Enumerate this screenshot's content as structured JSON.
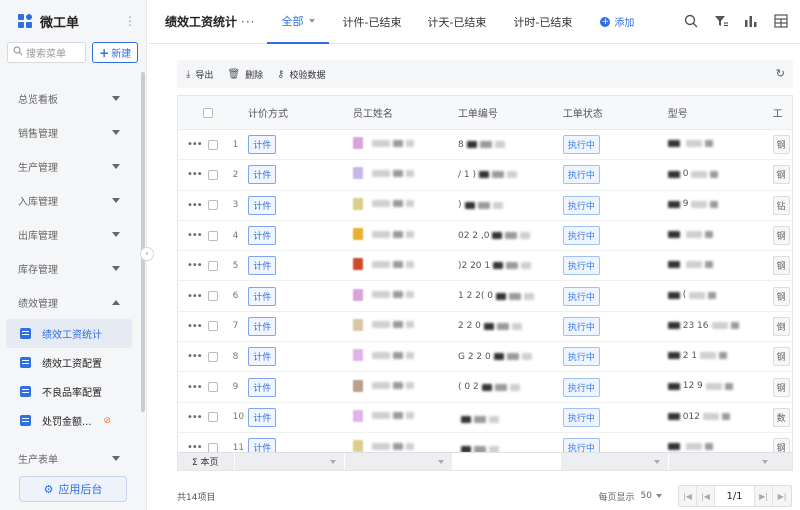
{
  "sidebar": {
    "app_title": "微工单",
    "search_placeholder": "搜索菜单",
    "new_button": "新建",
    "groups": [
      {
        "label": "总览看板"
      },
      {
        "label": "销售管理"
      },
      {
        "label": "生产管理"
      },
      {
        "label": "入库管理"
      },
      {
        "label": "出库管理"
      },
      {
        "label": "库存管理"
      }
    ],
    "perf_group": "绩效管理",
    "sub_items": [
      "绩效工资统计",
      "绩效工资配置",
      "不良品率配置",
      "处罚金额..."
    ],
    "prod_report": "生产表单",
    "app_backend": "应用后台"
  },
  "topbar": {
    "page_title": "绩效工资统计",
    "tabs": [
      "全部",
      "计件-已结束",
      "计天-已结束",
      "计时-已结束"
    ],
    "add_label": "添加"
  },
  "toolbar": {
    "export": "导出",
    "delete": "删除",
    "verify": "校验数据"
  },
  "table": {
    "headers": [
      "计价方式",
      "员工姓名",
      "工单编号",
      "工单状态",
      "型号",
      "工"
    ],
    "rows": [
      {
        "n": "1",
        "mode": "计件",
        "status": "执行中",
        "last": "钢",
        "no": "8",
        "model": ""
      },
      {
        "n": "2",
        "mode": "计件",
        "status": "执行中",
        "last": "钢",
        "no": "/ 1 )",
        "model": "0"
      },
      {
        "n": "3",
        "mode": "计件",
        "status": "执行中",
        "last": "钻",
        "no": ")",
        "model": "9"
      },
      {
        "n": "4",
        "mode": "计件",
        "status": "执行中",
        "last": "钢",
        "no": "02 2 ,0",
        "model": ""
      },
      {
        "n": "5",
        "mode": "计件",
        "status": "执行中",
        "last": "钢",
        "no": ")2 20 1",
        "model": ""
      },
      {
        "n": "6",
        "mode": "计件",
        "status": "执行中",
        "last": "钢",
        "no": "1 2 2( 0",
        "model": "("
      },
      {
        "n": "7",
        "mode": "计件",
        "status": "执行中",
        "last": "倒",
        "no": "2 2 0",
        "model": "23 16"
      },
      {
        "n": "8",
        "mode": "计件",
        "status": "执行中",
        "last": "钢",
        "no": "G 2 2 0",
        "model": "2 1"
      },
      {
        "n": "9",
        "mode": "计件",
        "status": "执行中",
        "last": "钢",
        "no": "( 0 2",
        "model": "12 9"
      },
      {
        "n": "10",
        "mode": "计件",
        "status": "执行中",
        "last": "数",
        "no": "",
        "model": "012"
      },
      {
        "n": "11",
        "mode": "计件",
        "status": "执行中",
        "last": "钢",
        "no": "",
        "model": ""
      }
    ],
    "sum_label": "Σ 本页"
  },
  "footer": {
    "total": "共14项目",
    "page_size_label": "每页显示",
    "page_size": "50",
    "page": "1/1"
  },
  "colors": {
    "accent": "#2f6fe0",
    "sidebar_bg": "#f5f6f8",
    "active_menu_bg": "#e6eaf3"
  }
}
